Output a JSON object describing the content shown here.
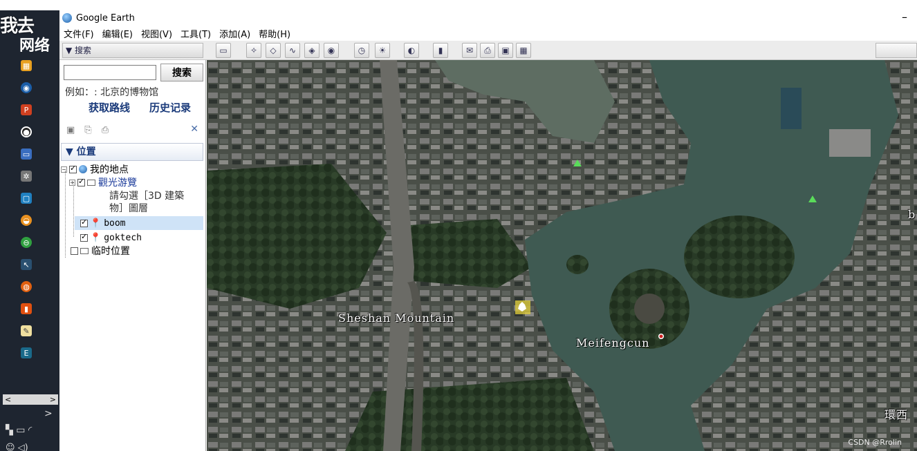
{
  "window": {
    "title": "Google Earth",
    "minimize_glyph": "–"
  },
  "menu": {
    "items": [
      "文件(F)",
      "编辑(E)",
      "视图(V)",
      "工具(T)",
      "添加(A)",
      "帮助(H)"
    ]
  },
  "overlay": {
    "line1": "我去",
    "line2": "网络"
  },
  "toolbar": {
    "sidebar_toggle_label": "▼ 搜索",
    "buttons": [
      {
        "icon": "sidebar-toggle-icon",
        "glyph": "▭"
      },
      {
        "icon": "add-placemark-icon",
        "glyph": "✧"
      },
      {
        "icon": "add-polygon-icon",
        "glyph": "◇"
      },
      {
        "icon": "add-path-icon",
        "glyph": "∿"
      },
      {
        "icon": "image-overlay-icon",
        "glyph": "◈"
      },
      {
        "icon": "record-tour-icon",
        "glyph": "◉"
      },
      {
        "icon": "historical-imagery-icon",
        "glyph": "◷"
      },
      {
        "icon": "sunlight-icon",
        "glyph": "☀"
      },
      {
        "icon": "planets-icon",
        "glyph": "◐"
      },
      {
        "icon": "ruler-icon",
        "glyph": "▮"
      },
      {
        "icon": "email-icon",
        "glyph": "✉"
      },
      {
        "icon": "print-icon",
        "glyph": "⎙"
      },
      {
        "icon": "save-image-icon",
        "glyph": "▣"
      },
      {
        "icon": "view-in-maps-icon",
        "glyph": "▦"
      }
    ]
  },
  "search": {
    "button_label": "搜索",
    "input_value": "",
    "example": "例如：: 北京的博物馆",
    "directions_label": "获取路线",
    "history_label": "历史记录"
  },
  "places": {
    "header": "▼ 位置",
    "close_glyph": "✕",
    "items": [
      {
        "label": "我的地点"
      },
      {
        "label": "觀光游覽"
      },
      {
        "label": "請勾選［3D 建築"
      },
      {
        "label": "物］圖層"
      },
      {
        "label": "boom"
      },
      {
        "label": "goktech"
      },
      {
        "label": "临时位置"
      }
    ]
  },
  "map": {
    "labels": [
      {
        "text": "Sheshan Mountain"
      },
      {
        "text": "Meifengcun"
      },
      {
        "text": "環西"
      },
      {
        "text": "b"
      }
    ],
    "watermark": "CSDN @Rrolin"
  },
  "taskbar": {
    "scroll_left": "<",
    "scroll_right": ">",
    "chevron": ">"
  }
}
